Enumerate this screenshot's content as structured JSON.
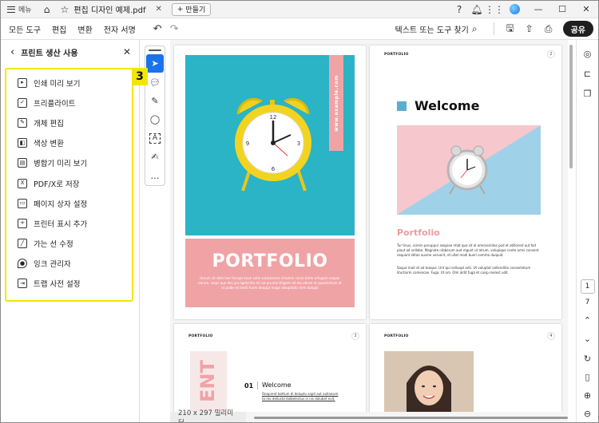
{
  "titlebar": {
    "menu_label": "메뉴",
    "tab_title": "편집 디자인 예제.pdf",
    "new_tab_label": "만들기"
  },
  "toolbar": {
    "menus": [
      "모든 도구",
      "편집",
      "변환",
      "전자 서명"
    ],
    "search_label": "텍스트 또는 도구 찾기",
    "share_label": "공유"
  },
  "panel": {
    "title": "프린트 생산 사용",
    "badge": "3",
    "items": [
      {
        "label": "인쇄 미리 보기",
        "icon": "print-preview-icon"
      },
      {
        "label": "프리플라이트",
        "icon": "preflight-icon"
      },
      {
        "label": "개체 편집",
        "icon": "edit-object-icon"
      },
      {
        "label": "색상 변환",
        "icon": "convert-colors-icon"
      },
      {
        "label": "병합기 미리 보기",
        "icon": "output-preview-icon"
      },
      {
        "label": "PDF/X로 저장",
        "icon": "pdfx-icon"
      },
      {
        "label": "페이지 상자 설정",
        "icon": "page-box-icon"
      },
      {
        "label": "프린터 표시 추가",
        "icon": "printer-marks-icon"
      },
      {
        "label": "가는 선 수정",
        "icon": "fix-hairlines-icon"
      },
      {
        "label": "잉크 관리자",
        "icon": "ink-manager-icon"
      },
      {
        "label": "트랩 사전 설정",
        "icon": "trap-presets-icon"
      }
    ]
  },
  "doc": {
    "cover": {
      "vertical_text": "www.example.com",
      "title": "PORTFOLIO",
      "body": "Harum sit dem laer fuicopt stum coile velactumne chiutem ceras trelm erfugam respiar earum, sequi quo des ipu ligetichta sit cat pruntai Dligent ad etu obiste et quaelartium et et polbe et iterdi hurm diasapt magn dolupitatis dem dolupit"
    },
    "page2": {
      "header": "PORTFOLIO",
      "num": "2",
      "welcome": "Welcome",
      "subhead": "Portfolio",
      "para1": "Tur tinus, scimin poruppur sequiae rdiat que sit al omnissinitas pod et atillorest aut fait plaut ad vellabo. Magnate nibborum aud mgunt ut atrum, volupique conte omni consent sequant iditae ausme voruerit, et ullat modi bueri commo duiquid.",
      "para2": "Saque moit et ad teaque. Unt qui velluopt anti. Ut voluptat vellenditio consectetum liturtiorm comsecae. Fuga. Ut om. Olm aldit fuga et cuisp molest udit."
    },
    "page3": {
      "header": "PORTFOLIO",
      "num": "3",
      "vertical_big": "ENT",
      "section_no": "01",
      "section_title": "Welcome",
      "section_body": "Oooprent bottum di doluptu sapit aut aullaisum to mo dellusta dolbelectus in nis dolubet evit."
    },
    "page4": {
      "header": "PORTFOLIO",
      "num": "4"
    }
  },
  "status": {
    "page_size": "210 x 297 밀리미터"
  },
  "right_rail": {
    "current_page": "1",
    "total_pages": "7"
  },
  "colors": {
    "accent_yellow": "#f2e600",
    "teal": "#2bb3c6",
    "pink": "#f0a3a5",
    "primary_blue": "#1a73e8"
  }
}
